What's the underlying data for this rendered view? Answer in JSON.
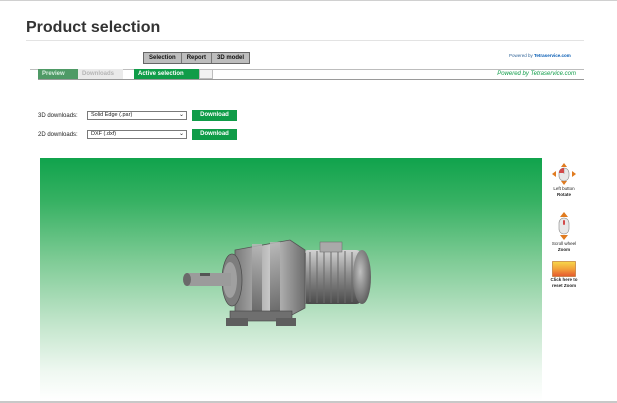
{
  "page": {
    "title": "Product selection"
  },
  "view_tabs": [
    {
      "label": "Selection"
    },
    {
      "label": "Report"
    },
    {
      "label": "3D model"
    }
  ],
  "powered_top": {
    "prefix": "Powered by ",
    "brand": "Tetraservice.com"
  },
  "tabs": {
    "preview": "Preview",
    "downloads": "Downloads",
    "active_selection": "Active selection"
  },
  "powered_right": "Powered by Tetraservice.com",
  "downloads": {
    "d3": {
      "label": "3D downloads:",
      "selected": "Solid Edge (.par)",
      "button": "Download"
    },
    "d2": {
      "label": "2D downloads:",
      "selected": "DXF (.dxf)",
      "button": "Download"
    }
  },
  "side_panel": {
    "rotate": {
      "line1": "Left button",
      "line2": "Rotate"
    },
    "zoom": {
      "line1": "Scroll wheel",
      "line2": "Zoom"
    },
    "reset": {
      "line1": "Click here to",
      "line2": "reset Zoom"
    }
  },
  "icons": {
    "rotate": "mouse-rotate-icon",
    "zoom": "mouse-scroll-icon",
    "reset": "reset-zoom-icon",
    "select": "chevron-down-icon"
  },
  "colors": {
    "accent_green": "#0f9c48",
    "viewer_top": "#10a34c",
    "link_blue": "#0059b3"
  }
}
